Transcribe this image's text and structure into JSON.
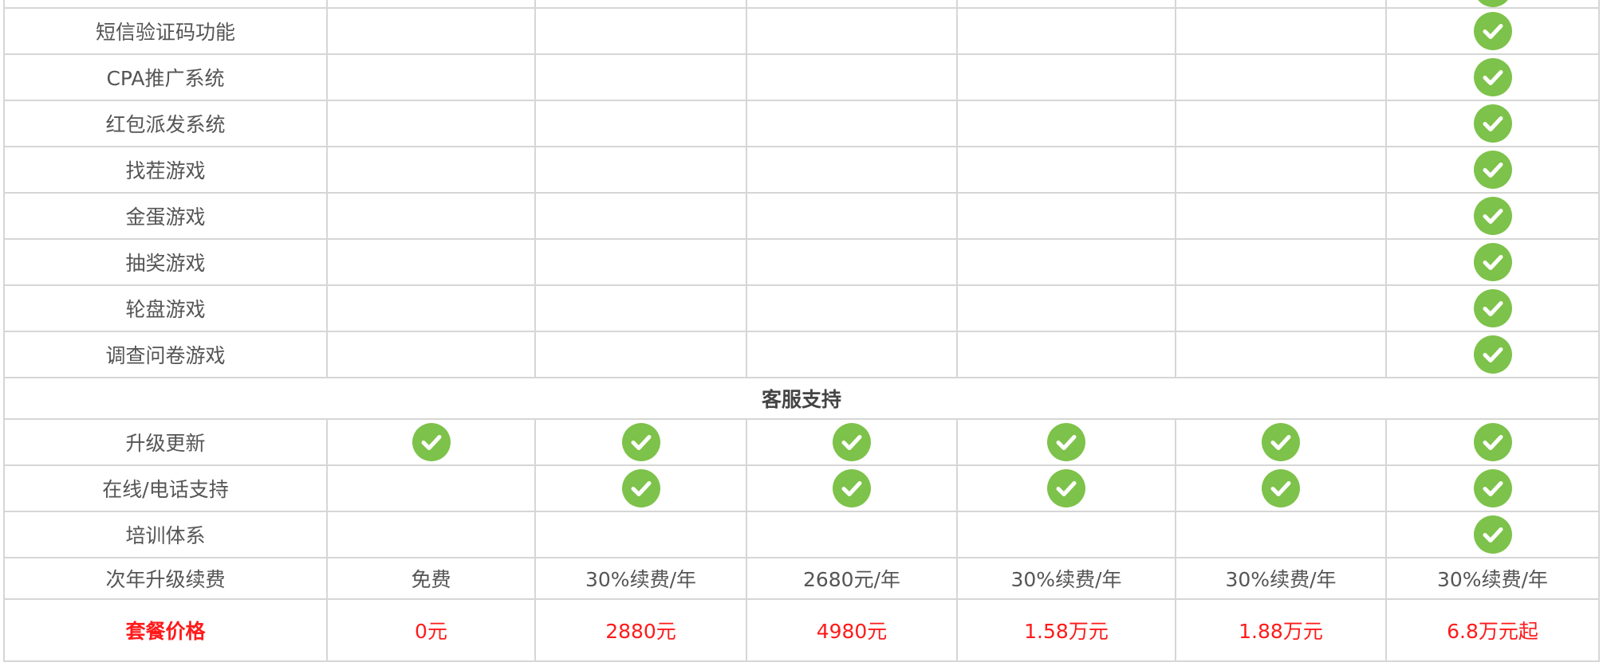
{
  "colors": {
    "check_green": "#7dc24a",
    "price_red": "#ff1a1a",
    "grid_line": "#d6d6d6",
    "text_gray": "#555555"
  },
  "icons": {
    "check": "check-circle-icon"
  },
  "feature_rows": [
    {
      "label": "短信验证码功能",
      "checks": [
        false,
        false,
        false,
        false,
        false,
        true
      ]
    },
    {
      "label": "CPA推广系统",
      "checks": [
        false,
        false,
        false,
        false,
        false,
        true
      ]
    },
    {
      "label": "红包派发系统",
      "checks": [
        false,
        false,
        false,
        false,
        false,
        true
      ]
    },
    {
      "label": "找茬游戏",
      "checks": [
        false,
        false,
        false,
        false,
        false,
        true
      ]
    },
    {
      "label": "金蛋游戏",
      "checks": [
        false,
        false,
        false,
        false,
        false,
        true
      ]
    },
    {
      "label": "抽奖游戏",
      "checks": [
        false,
        false,
        false,
        false,
        false,
        true
      ]
    },
    {
      "label": "轮盘游戏",
      "checks": [
        false,
        false,
        false,
        false,
        false,
        true
      ]
    },
    {
      "label": "调查问卷游戏",
      "checks": [
        false,
        false,
        false,
        false,
        false,
        true
      ]
    }
  ],
  "section_support": {
    "title": "客服支持"
  },
  "support_rows": [
    {
      "label": "升级更新",
      "checks": [
        true,
        true,
        true,
        true,
        true,
        true
      ]
    },
    {
      "label": "在线/电话支持",
      "checks": [
        false,
        true,
        true,
        true,
        true,
        true
      ]
    },
    {
      "label": "培训体系",
      "checks": [
        false,
        false,
        false,
        false,
        false,
        true
      ]
    }
  ],
  "renewal_row": {
    "label": "次年升级续费",
    "values": [
      "免费",
      "30%续费/年",
      "2680元/年",
      "30%续费/年",
      "30%续费/年",
      "30%续费/年"
    ]
  },
  "price_row": {
    "label": "套餐价格",
    "values": [
      "0元",
      "2880元",
      "4980元",
      "1.58万元",
      "1.88万元",
      "6.8万元起"
    ]
  }
}
